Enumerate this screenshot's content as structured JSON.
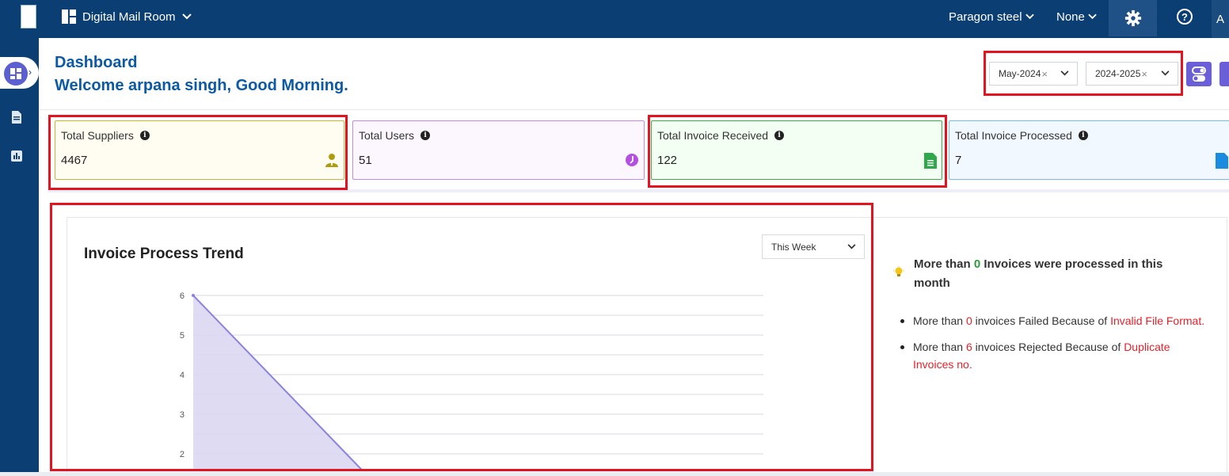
{
  "topbar": {
    "app_name": "Digital Mail Room",
    "organization": "Paragon steel",
    "scope": "None",
    "user_initial": "A"
  },
  "header": {
    "title": "Dashboard",
    "welcome": "Welcome arpana singh, Good Morning."
  },
  "filters": {
    "month": "May-2024",
    "fiscal_year": "2024-2025",
    "clear_glyph": "×"
  },
  "stats": [
    {
      "label": "Total Suppliers",
      "value": "4467",
      "icon": "supplier-icon",
      "color": "#b09a10"
    },
    {
      "label": "Total Users",
      "value": "51",
      "icon": "users-icon",
      "color": "#b44fe0"
    },
    {
      "label": "Total Invoice Received",
      "value": "122",
      "icon": "document-icon",
      "color": "#2ea84a"
    },
    {
      "label": "Total Invoice Processed",
      "value": "7",
      "icon": "processed-icon",
      "color": "#1a8ce0"
    }
  ],
  "chart_panel": {
    "title": "Invoice Process Trend",
    "period": "This Week"
  },
  "chart_data": {
    "type": "area",
    "title": "Invoice Process Trend",
    "x": [
      "",
      ""
    ],
    "values": [
      6,
      0
    ],
    "yticks": [
      "6",
      "5",
      "4",
      "3",
      "2"
    ],
    "ylim": [
      0,
      6
    ],
    "grid": true,
    "series_color": "#8a84dc",
    "fill_color": "#dad7f2"
  },
  "insights": {
    "headline_prefix": "More than",
    "headline_count": "0",
    "headline_suffix": "Invoices were processed in this month",
    "items": [
      {
        "prefix": "More than",
        "count": "0",
        "middle": "invoices Failed Because of",
        "reason": "Invalid File Format."
      },
      {
        "prefix": "More than",
        "count": "6",
        "middle": "invoices Rejected Because of",
        "reason": "Duplicate Invoices no."
      }
    ]
  }
}
